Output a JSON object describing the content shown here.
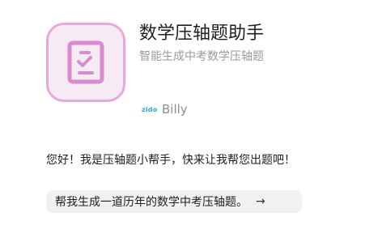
{
  "app": {
    "title": "数学压轴题助手",
    "subtitle": "智能生成中考数学压轴题",
    "icon": "checklist-document-icon",
    "icon_colors": {
      "border": "#e7a9db",
      "background": "#f6eaf4",
      "glyph": "#d98bd0"
    }
  },
  "author": {
    "logo_text": "zido",
    "name": "Billy"
  },
  "chat": {
    "greeting": "您好！我是压轴题小帮手，快来让我帮您出题吧！"
  },
  "suggestions": [
    {
      "text": "帮我生成一道历年的数学中考压轴题。",
      "arrow": "→"
    }
  ]
}
